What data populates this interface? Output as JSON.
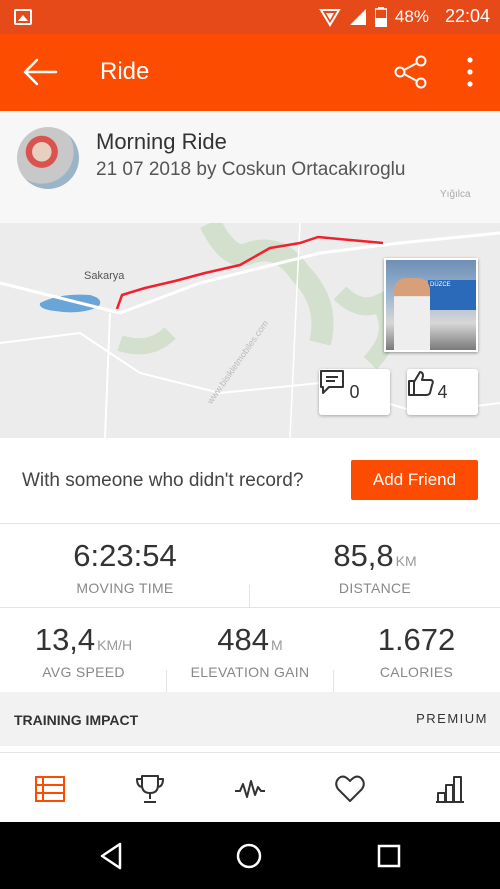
{
  "status_bar": {
    "battery": "48%",
    "time": "22:04",
    "icons": [
      "image-icon",
      "location-icon",
      "signal-icon",
      "battery-icon"
    ]
  },
  "app_bar": {
    "title": "Ride",
    "icons": [
      "back-arrow-icon",
      "share-icon",
      "more-vert-icon"
    ]
  },
  "activity": {
    "name": "Morning Ride",
    "meta": "21 07 2018 by Coskun Ortacakıroglu"
  },
  "map": {
    "city_label": "Sakarya",
    "corner_label": "Yığılca",
    "photo_sign_text": "DÜZCE",
    "comments_count": "0",
    "kudos_count": "4",
    "watermark": "www.bisikletmobiles.com",
    "route_color": "#f2202c"
  },
  "friend_prompt": {
    "text": "With someone who didn't record?",
    "button": "Add Friend"
  },
  "stats": {
    "moving_time": {
      "value": "6:23:54",
      "unit": "",
      "label": "MOVING TIME"
    },
    "distance": {
      "value": "85,8",
      "unit": "KM",
      "label": "DISTANCE"
    },
    "avg_speed": {
      "value": "13,4",
      "unit": "KM/H",
      "label": "AVG SPEED"
    },
    "elevation": {
      "value": "484",
      "unit": "M",
      "label": "ELEVATION GAIN"
    },
    "calories": {
      "value": "1.672",
      "unit": "",
      "label": "CALORIES"
    }
  },
  "training": {
    "title": "TRAINING IMPACT",
    "badge": "PREMIUM"
  },
  "tab_bar": {
    "items": [
      "feed-icon",
      "trophy-icon",
      "activity-pulse-icon",
      "heart-icon",
      "stats-bars-icon"
    ],
    "active_color": "#fc4c02"
  },
  "nav_bar": {
    "items": [
      "nav-back-icon",
      "nav-home-icon",
      "nav-recents-icon"
    ]
  },
  "colors": {
    "brand": "#fc4c02",
    "status_bar": "#e64a19"
  }
}
